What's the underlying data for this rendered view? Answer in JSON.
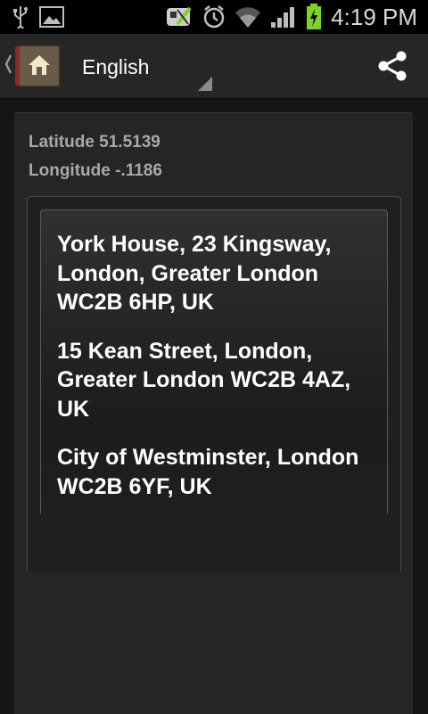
{
  "status_bar": {
    "time": "4:19 PM",
    "icons": [
      "usb-icon",
      "image-icon",
      "satellite-icon",
      "alarm-icon",
      "wifi-icon",
      "signal-icon",
      "battery-charging-icon"
    ]
  },
  "action_bar": {
    "language": "English",
    "icons": [
      "up-caret-icon",
      "home-icon",
      "spinner-arrow-icon",
      "share-icon"
    ]
  },
  "location": {
    "latitude": "Latitude 51.5139",
    "longitude": "Longitude -.1186"
  },
  "addresses": [
    "York House, 23 Kingsway, London, Greater London WC2B 6HP, UK",
    "15 Kean Street, London, Greater London WC2B 4AZ, UK",
    "City of Westminster, London WC2B 6YF, UK"
  ],
  "colors": {
    "status_bar": "#000000",
    "action_bar": "#262626",
    "background": "#161616",
    "card": "#252525",
    "address_text": "#ffffff",
    "coord_text": "#a8a8a8",
    "battery_charge": "#7ed321"
  }
}
